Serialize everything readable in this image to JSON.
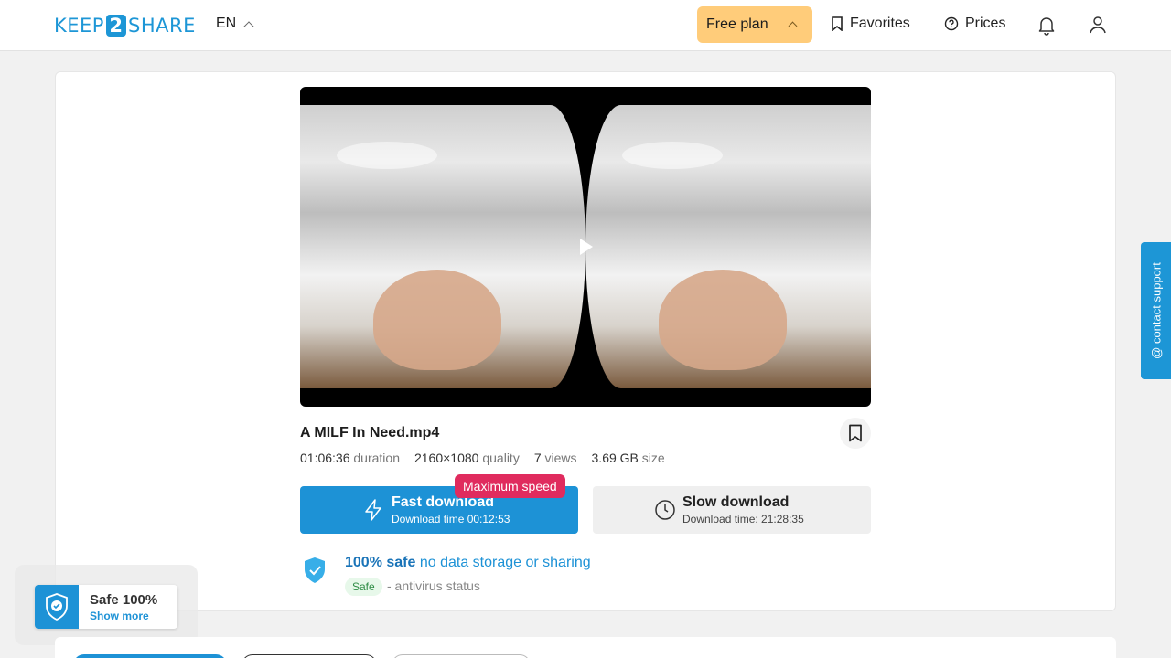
{
  "header": {
    "logo_left": "KEEP",
    "logo_number": "2",
    "logo_right": "SHARE",
    "language": "EN",
    "plan_label": "Free plan",
    "favorites_label": "Favorites",
    "prices_label": "Prices"
  },
  "file": {
    "title": "A MILF In Need.mp4",
    "duration_value": "01:06:36",
    "duration_label": "duration",
    "quality_value": "2160×1080",
    "quality_label": "quality",
    "views_value": "7",
    "views_label": "views",
    "size_value": "3.69 GB",
    "size_label": "size"
  },
  "downloads": {
    "badge": "Maximum speed",
    "fast_title": "Fast download",
    "fast_time": "Download time 00:12:53",
    "slow_title": "Slow download",
    "slow_time": "Download time: 21:28:35"
  },
  "safety": {
    "headline_bold": "100% safe",
    "headline_rest": "no data storage or sharing",
    "status_pill": "Safe",
    "status_text": "- antivirus status"
  },
  "safe_widget": {
    "title": "Safe 100%",
    "link": "Show more"
  },
  "contact_support": "@ contact support",
  "colors": {
    "brand": "#1d96d6",
    "plan": "#ffcc7a",
    "badge": "#e02b5e"
  }
}
